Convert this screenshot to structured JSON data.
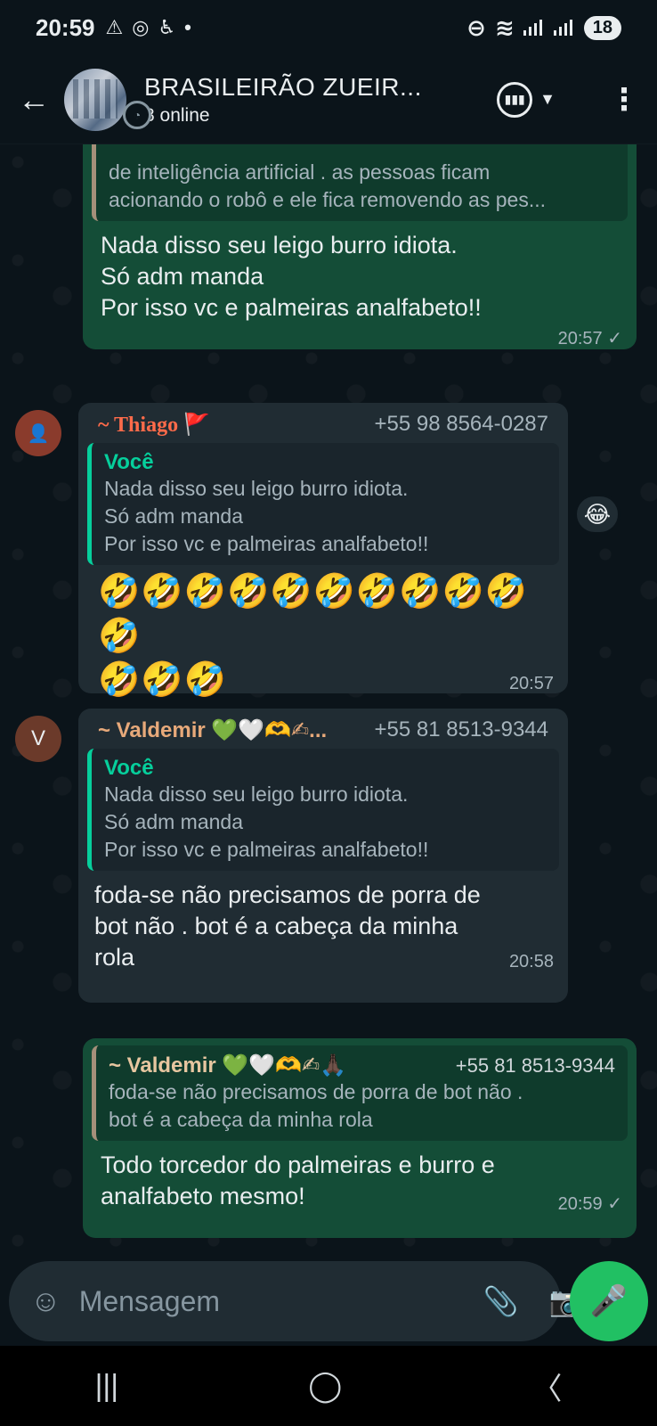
{
  "status_bar": {
    "time": "20:59",
    "battery": "18"
  },
  "header": {
    "title": "BRASILEIRÃO ZUEIR...",
    "subtitle": "8 online"
  },
  "messages": {
    "m1": {
      "quote_line1": "de inteligência  artificial . as pessoas ficam",
      "quote_line2": "acionando o robô e ele fica removendo as pes...",
      "line1": "Nada disso seu leigo burro idiota.",
      "line2": "Só adm manda",
      "line3": "Por isso vc e palmeiras analfabeto!!",
      "time": "20:57 ✓",
      "reaction": "😂"
    },
    "m2": {
      "avatar": "👤",
      "sender": "~ Thiago 🚩",
      "phone": "+55 98 8564-0287",
      "quote_author": "Você",
      "quote_line1": "Nada disso seu leigo burro idiota.",
      "quote_line2": "Só adm manda",
      "quote_line3": "Por isso vc e palmeiras analfabeto!!",
      "emoji_line1": "🤣🤣🤣🤣🤣🤣🤣🤣🤣🤣🤣",
      "emoji_line2": "🤣🤣🤣",
      "time": "20:57"
    },
    "m3": {
      "avatar": "V",
      "sender": "~ Valdemir 💚🤍🫶✍...",
      "phone": "+55 81 8513-9344",
      "quote_author": "Você",
      "quote_line1": "Nada disso seu leigo burro idiota.",
      "quote_line2": "Só adm manda",
      "quote_line3": "Por isso vc e palmeiras analfabeto!!",
      "line1": "foda-se  não precisamos de porra de",
      "line2": "bot não . bot é a cabeça da minha",
      "line3": "rola",
      "time": "20:58"
    },
    "m4": {
      "quote_author": "~ Valdemir 💚🤍🫶✍🙏🏿",
      "quote_phone": "+55 81 8513-9344",
      "quote_line1": "foda-se  não precisamos de porra de bot não .",
      "quote_line2": "bot é a cabeça da minha rola",
      "line1": "Todo torcedor do palmeiras e burro e",
      "line2": "analfabeto mesmo!",
      "time": "20:59 ✓"
    }
  },
  "composer": {
    "placeholder": "Mensagem"
  },
  "colors": {
    "background": "#0b141a",
    "outgoing_bubble": "#144d37",
    "incoming_bubble": "#202c33",
    "accent_green": "#21c063",
    "quote_you": "#06cf9c",
    "thiago_name": "#ff6b4a",
    "valdemir_name": "#e7a97a"
  },
  "icons": {
    "back": "←",
    "menu": "⋮",
    "sticker": "☺",
    "attach": "📎",
    "camera": "📷",
    "mic": "🎤",
    "nav_recent": "|||",
    "nav_home": "◯",
    "nav_back": "〈"
  }
}
